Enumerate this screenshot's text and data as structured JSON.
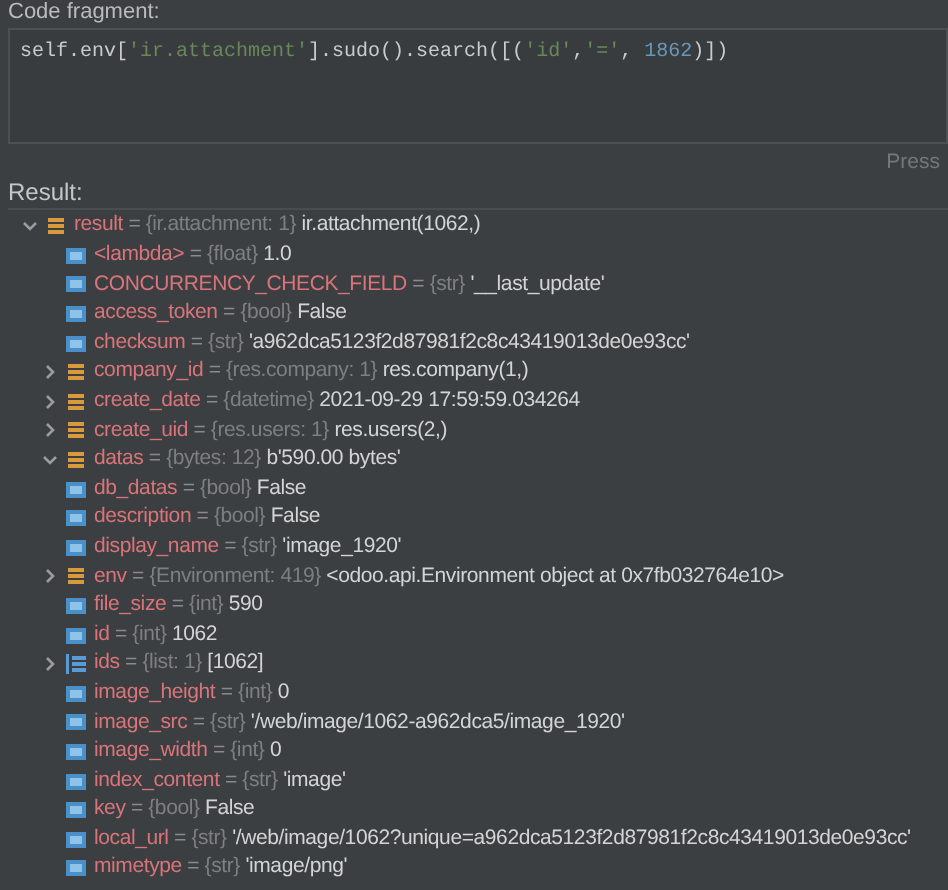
{
  "code_fragment": {
    "label": "Code fragment:",
    "tokens": [
      {
        "kind": "plain",
        "text": "self.env["
      },
      {
        "kind": "string",
        "text": "'ir.attachment'"
      },
      {
        "kind": "plain",
        "text": "].sudo().search([("
      },
      {
        "kind": "string",
        "text": "'id'"
      },
      {
        "kind": "plain",
        "text": ","
      },
      {
        "kind": "string",
        "text": "'='"
      },
      {
        "kind": "plain",
        "text": ", "
      },
      {
        "kind": "number",
        "text": "1862"
      },
      {
        "kind": "plain",
        "text": ")])"
      }
    ],
    "hint": "Press"
  },
  "result": {
    "label": "Result:",
    "tree": [
      {
        "name": "result",
        "eq": "=",
        "type": "{ir.attachment: 1}",
        "value": "ir.attachment(1062,)",
        "kind": "object",
        "expanded": true,
        "children": [
          {
            "name": "<lambda>",
            "eq": "=",
            "type": "{float}",
            "value": "1.0",
            "kind": "primitive"
          },
          {
            "name": "CONCURRENCY_CHECK_FIELD",
            "eq": "=",
            "type": "{str}",
            "value": "'__last_update'",
            "kind": "primitive"
          },
          {
            "name": "access_token",
            "eq": "=",
            "type": "{bool}",
            "value": "False",
            "kind": "primitive"
          },
          {
            "name": "checksum",
            "eq": "=",
            "type": "{str}",
            "value": "'a962dca5123f2d87981f2c8c43419013de0e93cc'",
            "kind": "primitive"
          },
          {
            "name": "company_id",
            "eq": "=",
            "type": "{res.company: 1}",
            "value": "res.company(1,)",
            "kind": "object",
            "expanded": false
          },
          {
            "name": "create_date",
            "eq": "=",
            "type": "{datetime}",
            "value": "2021-09-29 17:59:59.034264",
            "kind": "object",
            "expanded": false
          },
          {
            "name": "create_uid",
            "eq": "=",
            "type": "{res.users: 1}",
            "value": "res.users(2,)",
            "kind": "object",
            "expanded": false
          },
          {
            "name": "datas",
            "eq": "=",
            "type": "{bytes: 12}",
            "value": "b'590.00 bytes'",
            "kind": "object",
            "expanded": true
          },
          {
            "name": "db_datas",
            "eq": "=",
            "type": "{bool}",
            "value": "False",
            "kind": "primitive"
          },
          {
            "name": "description",
            "eq": "=",
            "type": "{bool}",
            "value": "False",
            "kind": "primitive"
          },
          {
            "name": "display_name",
            "eq": "=",
            "type": "{str}",
            "value": "'image_1920'",
            "kind": "primitive"
          },
          {
            "name": "env",
            "eq": "=",
            "type": "{Environment: 419}",
            "value": "<odoo.api.Environment object at 0x7fb032764e10>",
            "kind": "object",
            "expanded": false
          },
          {
            "name": "file_size",
            "eq": "=",
            "type": "{int}",
            "value": "590",
            "kind": "primitive"
          },
          {
            "name": "id",
            "eq": "=",
            "type": "{int}",
            "value": "1062",
            "kind": "primitive"
          },
          {
            "name": "ids",
            "eq": "=",
            "type": "{list: 1}",
            "value": "[1062]",
            "kind": "list",
            "expanded": false
          },
          {
            "name": "image_height",
            "eq": "=",
            "type": "{int}",
            "value": "0",
            "kind": "primitive"
          },
          {
            "name": "image_src",
            "eq": "=",
            "type": "{str}",
            "value": "'/web/image/1062-a962dca5/image_1920'",
            "kind": "primitive"
          },
          {
            "name": "image_width",
            "eq": "=",
            "type": "{int}",
            "value": "0",
            "kind": "primitive"
          },
          {
            "name": "index_content",
            "eq": "=",
            "type": "{str}",
            "value": "'image'",
            "kind": "primitive"
          },
          {
            "name": "key",
            "eq": "=",
            "type": "{bool}",
            "value": "False",
            "kind": "primitive"
          },
          {
            "name": "local_url",
            "eq": "=",
            "type": "{str}",
            "value": "'/web/image/1062?unique=a962dca5123f2d87981f2c8c43419013de0e93cc'",
            "kind": "primitive"
          },
          {
            "name": "mimetype",
            "eq": "=",
            "type": "{str}",
            "value": "'image/png'",
            "kind": "primitive"
          }
        ]
      }
    ]
  }
}
